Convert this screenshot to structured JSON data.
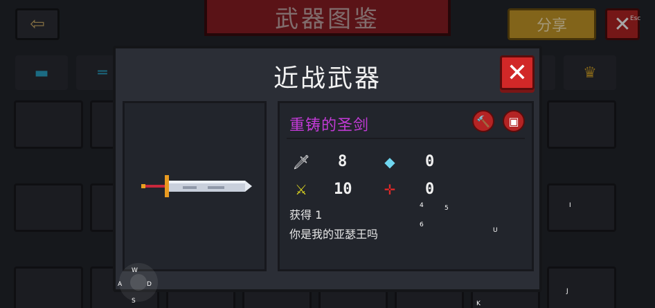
{
  "header": {
    "title": "武器图鉴",
    "back_icon": "back-arrow-icon",
    "share_label": "分享",
    "close_label": "✕",
    "esc_hint": "Esc"
  },
  "modal": {
    "title": "近战武器",
    "close_label": "✕"
  },
  "weapon": {
    "name": "重铸的圣剑",
    "name_color": "#c23ad6",
    "attack": "8",
    "energy": "0",
    "crit": "10",
    "accuracy": "0",
    "acquire_label": "获得",
    "acquire_count": "1",
    "description": "你是我的亚瑟王吗"
  },
  "key_hints": {
    "w": "W",
    "a": "A",
    "s": "S",
    "d": "D",
    "k4": "4",
    "k5": "5",
    "k6": "6",
    "u": "U",
    "i": "I",
    "j": "J",
    "k": "K"
  },
  "colors": {
    "accent_red": "#d12828",
    "gold": "#c89a28",
    "banner": "#8a1e24"
  }
}
